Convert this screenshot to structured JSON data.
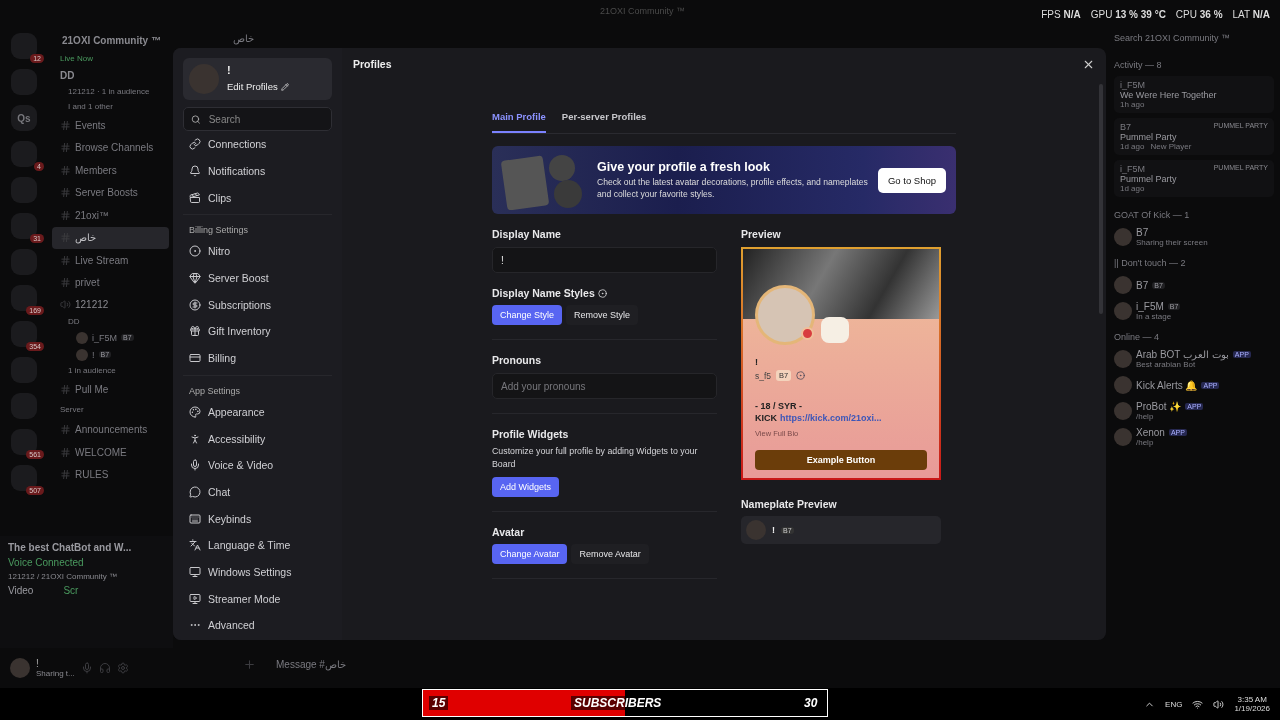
{
  "titlebar": {
    "title": "21OXI Community ™",
    "stats": [
      {
        "label": "FPS",
        "value": "N/A"
      },
      {
        "label": "GPU",
        "value": "13 % 39 °C"
      },
      {
        "label": "CPU",
        "value": "36 %"
      },
      {
        "label": "LAT",
        "value": "N/A"
      }
    ]
  },
  "server": {
    "name": "21OXI Community ™",
    "channel_header": "خاص",
    "rail": [
      {
        "kind": "badged",
        "badge": "12"
      },
      {
        "kind": "plain"
      },
      {
        "kind": "text",
        "label": "Qs"
      },
      {
        "kind": "badged",
        "badge": "4"
      },
      {
        "kind": "plain"
      },
      {
        "kind": "badged",
        "badge": "31"
      },
      {
        "kind": "plain"
      },
      {
        "kind": "badged",
        "badge": "169"
      },
      {
        "kind": "badged",
        "badge": "354"
      },
      {
        "kind": "plain"
      },
      {
        "kind": "plain"
      },
      {
        "kind": "badged",
        "badge": "561"
      },
      {
        "kind": "badged",
        "badge": "507"
      }
    ],
    "channels": [
      {
        "kind": "live",
        "label": "Live Now"
      },
      {
        "kind": "title",
        "label": "DD"
      },
      {
        "kind": "meta",
        "label": "121212 · 1 in audience"
      },
      {
        "kind": "meta",
        "label": "I and 1 other"
      },
      {
        "kind": "channel",
        "label": "Events",
        "selected": false
      },
      {
        "kind": "channel",
        "label": "Browse Channels",
        "selected": false
      },
      {
        "kind": "channel",
        "label": "Members",
        "selected": false
      },
      {
        "kind": "channel",
        "label": "Server Boosts",
        "selected": false
      },
      {
        "kind": "channel",
        "label": "21oxi™",
        "selected": false
      },
      {
        "kind": "channel",
        "label": "خاص",
        "selected": true
      },
      {
        "kind": "channel",
        "label": "Live Stream",
        "selected": false
      },
      {
        "kind": "channel",
        "label": "privet",
        "selected": false
      },
      {
        "kind": "voice",
        "label": "121212",
        "selected": false
      },
      {
        "kind": "meta",
        "label": "DD"
      },
      {
        "kind": "user",
        "label": "i_F5M",
        "tag": "B7"
      },
      {
        "kind": "user",
        "label": "!",
        "tag": "B7"
      },
      {
        "kind": "meta",
        "label": "1 in audience"
      },
      {
        "kind": "channel",
        "label": "Pull Me",
        "selected": false
      },
      {
        "kind": "section",
        "label": "Server"
      },
      {
        "kind": "channel",
        "label": "Announcements",
        "selected": false
      },
      {
        "kind": "channel",
        "label": "WELCOME",
        "selected": false
      },
      {
        "kind": "channel",
        "label": "RULES",
        "selected": false
      }
    ],
    "stream": {
      "title": "The best ChatBot and W...",
      "voice_status": "Voice Connected",
      "voice_place": "121212 / 21OXI Community ™",
      "video": "Video",
      "screen": "Scr"
    },
    "user": {
      "name": "!",
      "status": "Sharing t..."
    },
    "message_placeholder": "Message #خاص"
  },
  "settings": {
    "profile": {
      "name": "!",
      "edit": "Edit Profiles"
    },
    "search": {
      "placeholder": "Search"
    },
    "groups": [
      {
        "items": [
          "Connections",
          "Notifications",
          "Clips"
        ]
      },
      {
        "heading": "Billing Settings",
        "items": [
          "Nitro",
          "Server Boost",
          "Subscriptions",
          "Gift Inventory",
          "Billing"
        ]
      },
      {
        "heading": "App Settings",
        "items": [
          "Appearance",
          "Accessibility",
          "Voice & Video",
          "Chat",
          "Keybinds",
          "Language & Time",
          "Windows Settings",
          "Streamer Mode",
          "Advanced"
        ]
      }
    ]
  },
  "page": {
    "title": "Profiles",
    "tabs": [
      {
        "label": "Main Profile",
        "selected": true
      },
      {
        "label": "Per-server Profiles",
        "selected": false
      }
    ],
    "banner": {
      "title": "Give your profile a fresh look",
      "text": "Check out the latest avatar decorations, profile effects, and nameplates and collect your favorite styles.",
      "button": "Go to Shop"
    },
    "display_name": {
      "label": "Display Name",
      "value": "!"
    },
    "name_styles": {
      "label": "Display Name Styles",
      "primary": "Change Style",
      "secondary": "Remove Style"
    },
    "pronouns": {
      "label": "Pronouns",
      "placeholder": "Add your pronouns"
    },
    "widgets": {
      "label": "Profile Widgets",
      "description": "Customize your full profile by adding Widgets to your Board",
      "button": "Add Widgets"
    },
    "avatar": {
      "label": "Avatar",
      "primary": "Change Avatar",
      "secondary": "Remove Avatar"
    },
    "preview": {
      "label": "Preview",
      "name": "!",
      "username": "s_f5",
      "tag": "B7",
      "bio": "- 18 / SYR  -",
      "kick": "KICK",
      "link": "https://kick.com/21oxi...",
      "view_full": "View Full Bio",
      "button": "Example Button"
    },
    "nameplate": {
      "label": "Nameplate Preview",
      "name": "!",
      "tag": "B7"
    }
  },
  "members": {
    "search_placeholder": "Search 21OXI Community ™",
    "activity_heading": "Activity — 8",
    "activity": [
      {
        "user": "i_F5M",
        "game": "We Were Here Together",
        "time": "1h ago"
      },
      {
        "user": "B7",
        "game": "Pummel Party",
        "time": "1d ago",
        "extra": "New Player",
        "art": "PUMMEL PARTY"
      },
      {
        "user": "i_F5M",
        "game": "Pummel Party",
        "time": "1d ago",
        "art": "PUMMEL PARTY"
      }
    ],
    "groups": [
      {
        "heading": "GOAT Of Kick — 1",
        "members": [
          {
            "name": "B7",
            "status": "Sharing their screen"
          }
        ]
      },
      {
        "heading": "|| Don't touch — 2",
        "members": [
          {
            "name": "B7",
            "tag": "B7"
          },
          {
            "name": "i_F5M",
            "tag": "B7",
            "status": "In a stage"
          }
        ]
      },
      {
        "heading": "Online — 4",
        "members": [
          {
            "name": "Arab BOT بوت العرب",
            "app": "APP",
            "status": "Best arabian Bot"
          },
          {
            "name": "Kick Alerts 🔔",
            "app": "APP"
          },
          {
            "name": "ProBot ✨",
            "app": "APP",
            "status": "/help"
          },
          {
            "name": "Xenon",
            "app": "APP",
            "status": "/help"
          }
        ]
      }
    ]
  },
  "taskbar": {
    "count": "15",
    "label": "SUBSCRIBERS",
    "goal": "30",
    "level": 0.5,
    "language": "ENG",
    "time": "3:35 AM",
    "date": "1/19/2026"
  }
}
